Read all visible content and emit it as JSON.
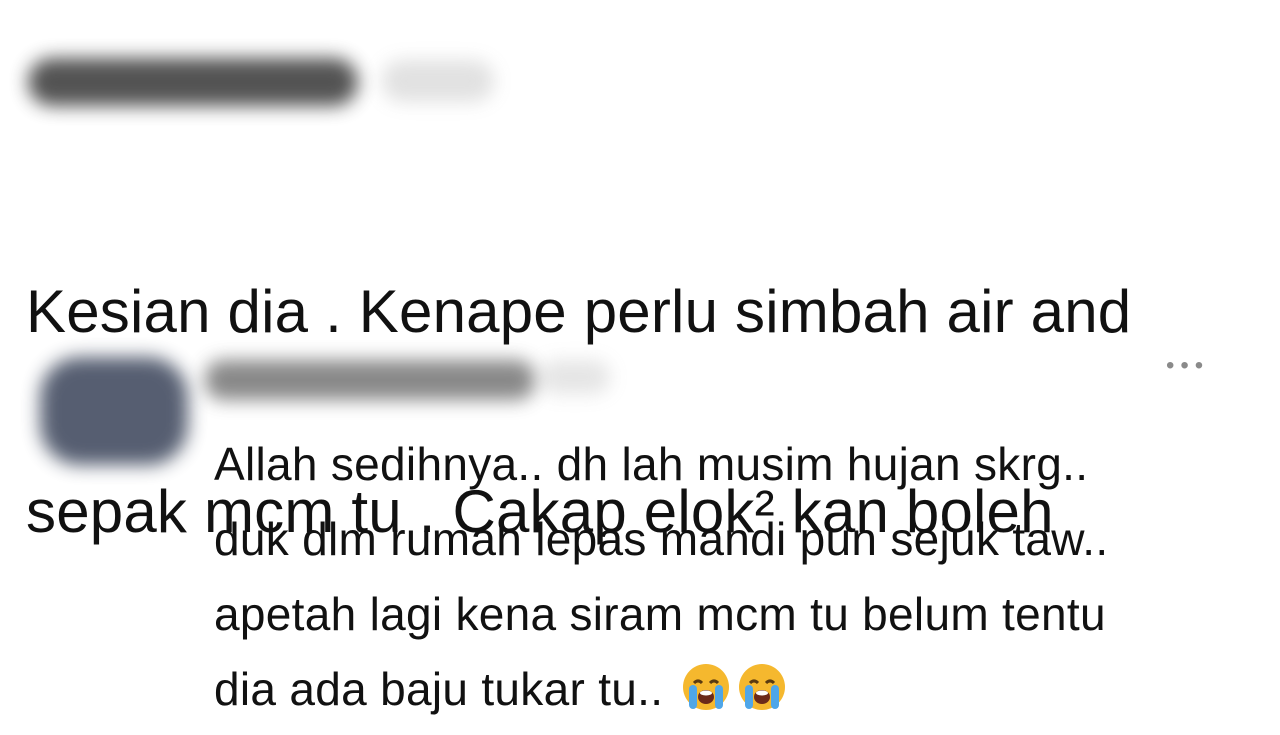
{
  "comment1": {
    "author": "",
    "time": "",
    "lines": [
      "Kesian dia . Kenape perlu simbah air and",
      "sepak mcm tu . Cakap elok² kan boleh"
    ]
  },
  "comment2": {
    "author": "",
    "menu_label": "•••",
    "lines": [
      "Allah sedihnya.. dh lah musim hujan skrg..",
      "duk dlm rumah lepas mandi pun sejuk taw..",
      "apetah lagi kena siram mcm tu belum tentu",
      "dia ada baju tukar tu.."
    ],
    "emojis": [
      "loudly-crying-face-icon",
      "loudly-crying-face-icon"
    ]
  },
  "colors": {
    "text": "#111111",
    "emoji_face": "#F5B82E",
    "tears": "#4FA6E8"
  }
}
